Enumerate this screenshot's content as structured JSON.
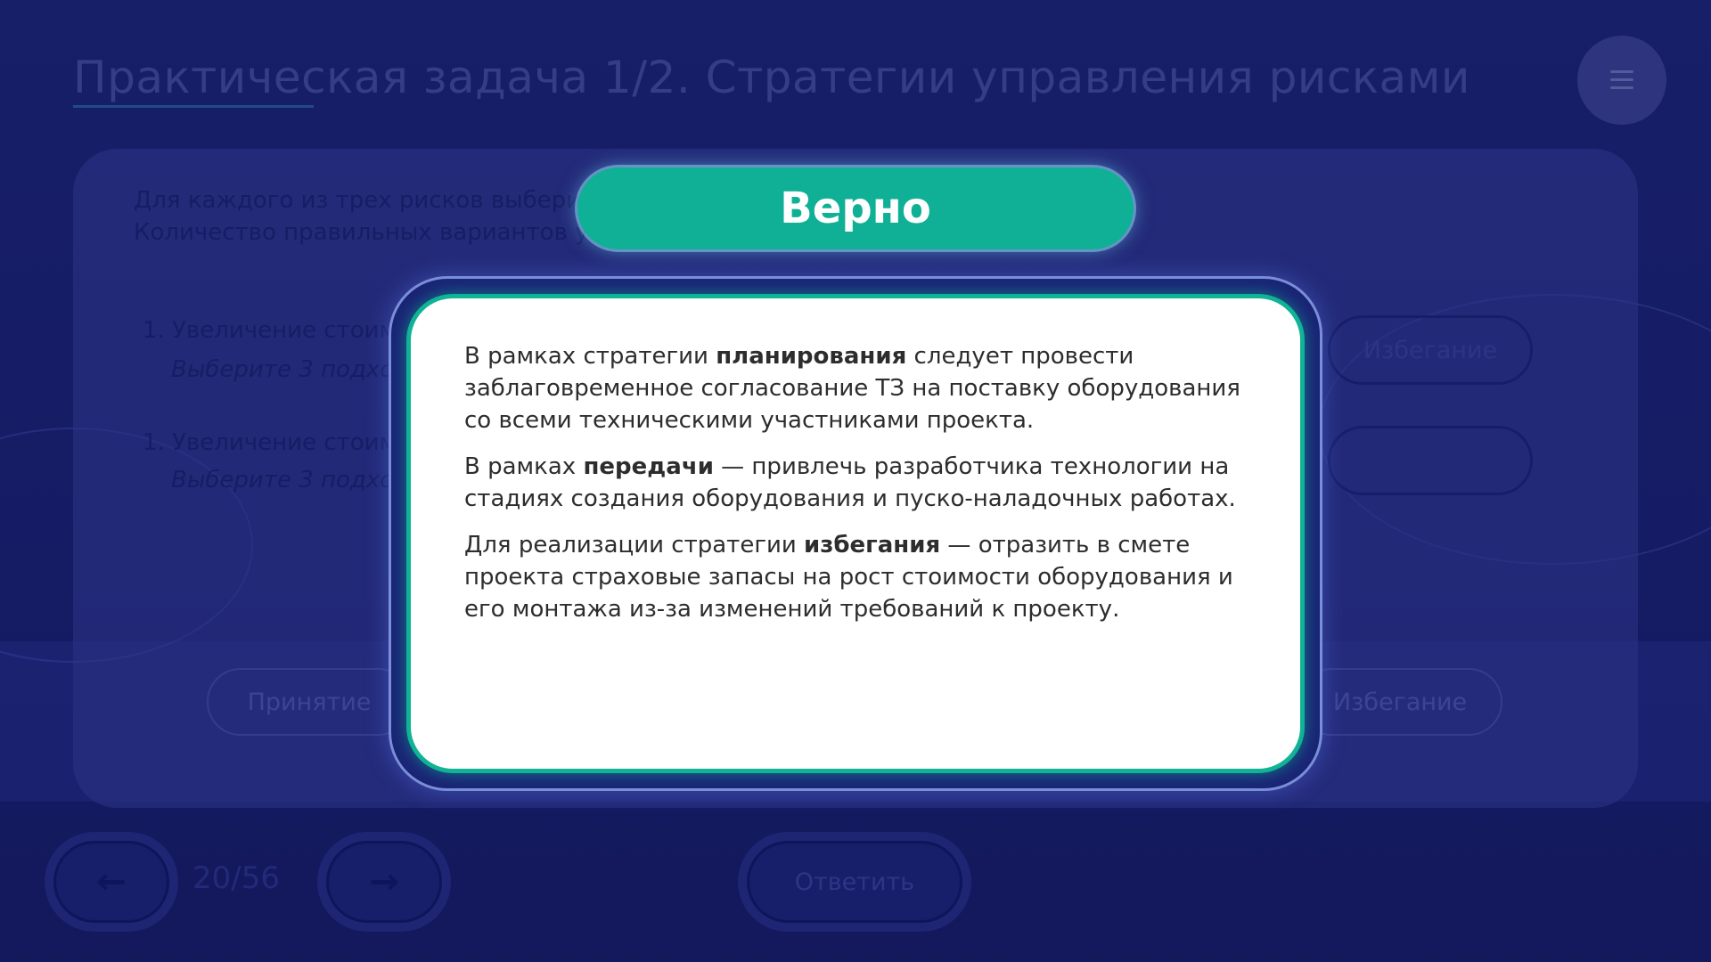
{
  "header": {
    "title": "Практическая задача 1/2. Стратегии управления рисками"
  },
  "task": {
    "instruction_line1": "Для каждого из трех рисков выберите",
    "instruction_line2": "Количество правильных вариантов ук",
    "items": [
      {
        "label": "1. Увеличение стоим",
        "hint": "Выберите 3 подход"
      },
      {
        "label": "1. Увеличение стоим",
        "hint": "Выберите 3 подход"
      }
    ],
    "option_right_top": "Избегание",
    "bottom_options": [
      "Принятие",
      "Избегание"
    ]
  },
  "footer": {
    "counter_current": "20",
    "counter_sep": "/",
    "counter_total": "56",
    "answer_label": "Ответить",
    "prev_arrow": "←",
    "next_arrow": "→"
  },
  "modal": {
    "verdict": "Верно",
    "paragraphs": [
      {
        "before": "В рамках стратегии ",
        "bold": "планирования",
        "after": " следует провести заблаговременное согласование ТЗ на поставку оборудования со всеми техническими участниками проекта."
      },
      {
        "before": "В рамках ",
        "bold": "передачи",
        "after": " — привлечь разработчика технологии на стадиях создания оборудования и пуско-наладочных работах."
      },
      {
        "before": "Для реализации стратегии ",
        "bold": "избегания",
        "after": " — отразить в смете проекта страховые запасы на рост стоимости оборудования и его монтажа из-за изменений требований к проекту."
      }
    ]
  },
  "colors": {
    "background": "#1b2374",
    "success": "#0fb095",
    "modal_bg": "#ffffff",
    "text_dark": "#2d2d2d"
  }
}
